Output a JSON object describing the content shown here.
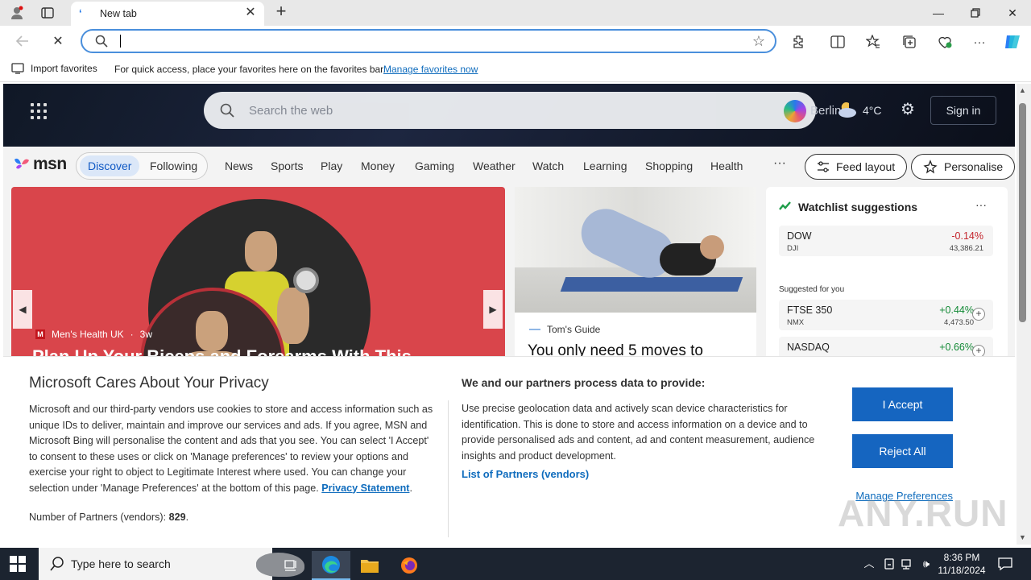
{
  "browser": {
    "tab_title": "New tab",
    "address_value": "",
    "favbar": {
      "import_label": "Import favorites",
      "message": "For quick access, place your favorites here on the favorites bar.",
      "manage_link": "Manage favorites now"
    }
  },
  "msn": {
    "search_placeholder": "Search the web",
    "weather": {
      "location": "Berlin",
      "temp": "4°C"
    },
    "signin_label": "Sign in",
    "logo_text": "msn",
    "pills": {
      "discover": "Discover",
      "following": "Following"
    },
    "nav_links": [
      "News",
      "Sports",
      "Play",
      "Money",
      "Gaming",
      "Weather",
      "Watch",
      "Learning",
      "Shopping",
      "Health"
    ],
    "more_label": "···",
    "feed_layout_label": "Feed layout",
    "personalise_label": "Personalise",
    "main_card": {
      "source_logo": "M",
      "source": "Men's Health UK",
      "age": "3w",
      "headline": "Plan Up Your Biceps and Forearms With This"
    },
    "side_card": {
      "source": "Tom's Guide",
      "headline": "You only need 5 moves to"
    },
    "watchlist": {
      "title": "Watchlist suggestions",
      "more": "···",
      "suggested_label": "Suggested for you",
      "tickers": [
        {
          "name": "DOW",
          "sub": "DJI",
          "change": "-0.14%",
          "value": "43,386.21",
          "direction": "down"
        },
        {
          "name": "FTSE 350",
          "sub": "NMX",
          "change": "+0.44%",
          "value": "4,473.50",
          "direction": "up"
        },
        {
          "name": "NASDAQ",
          "sub": "",
          "change": "+0.66%",
          "value": "",
          "direction": "up"
        }
      ]
    }
  },
  "privacy": {
    "title": "Microsoft Cares About Your Privacy",
    "body": "Microsoft and our third-party vendors use cookies to store and access information such as unique IDs to deliver, maintain and improve our services and ads. If you agree, MSN and Microsoft Bing will personalise the content and ads that you see. You can select 'I Accept' to consent to these uses or click on 'Manage preferences' to review your options and exercise your right to object to Legitimate Interest where used.  You can change your selection under 'Manage Preferences' at the bottom of this page.",
    "privacy_link": "Privacy Statement",
    "partners_label": "Number of Partners (vendors):",
    "partners_count": "829",
    "title2": "We and our partners process data to provide:",
    "body2": "Use precise geolocation data and actively scan device characteristics for identification. This is done to store and access information on a device and to provide personalised ads and content, ad and content measurement, audience insights and product development.",
    "list_link": "List of Partners (vendors)",
    "accept_label": "I Accept",
    "reject_label": "Reject All",
    "manage_label": "Manage Preferences"
  },
  "watermark": "ANY.RUN",
  "taskbar": {
    "search_placeholder": "Type here to search",
    "time": "8:36 PM",
    "date": "11/18/2024"
  },
  "colors": {
    "accent": "#1565c0",
    "link": "#0f6cbd",
    "negative": "#c4262e",
    "positive": "#138a36"
  }
}
